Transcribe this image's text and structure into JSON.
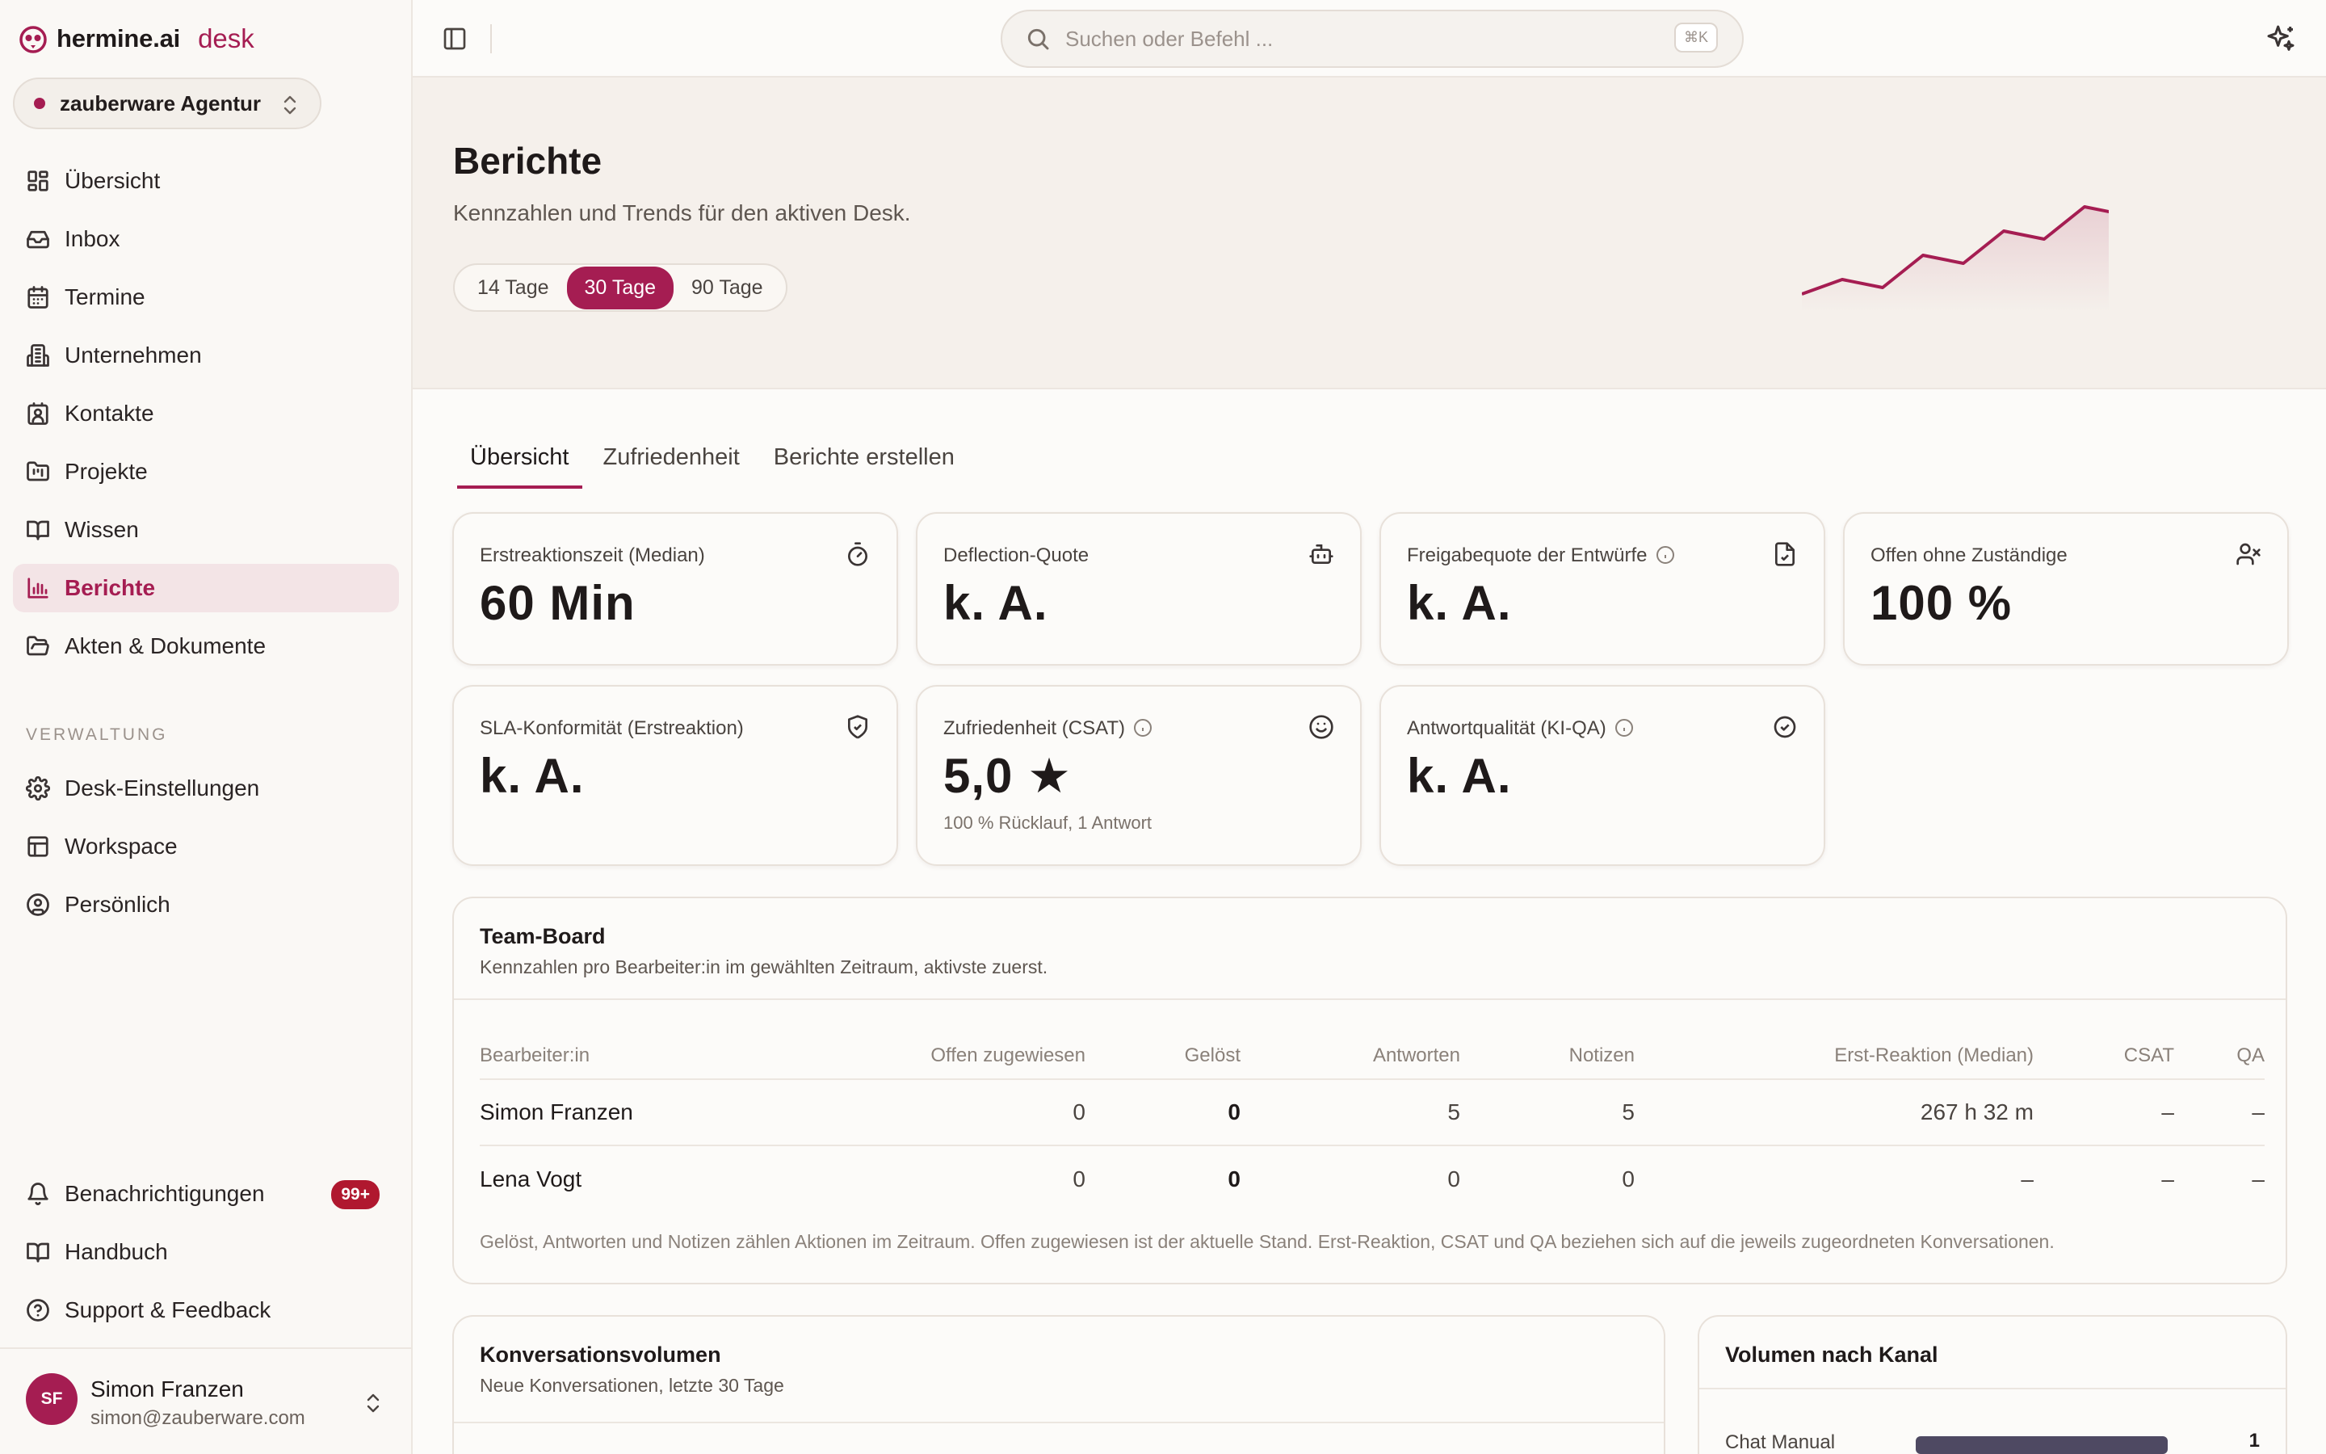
{
  "brand": {
    "name": "hermine.ai",
    "product": "desk"
  },
  "workspace": {
    "name": "zauberware Agentur"
  },
  "nav": {
    "items": [
      {
        "label": "Übersicht",
        "icon": "dashboard-icon"
      },
      {
        "label": "Inbox",
        "icon": "inbox-icon"
      },
      {
        "label": "Termine",
        "icon": "calendar-icon"
      },
      {
        "label": "Unternehmen",
        "icon": "building-icon"
      },
      {
        "label": "Kontakte",
        "icon": "contact-icon"
      },
      {
        "label": "Projekte",
        "icon": "folder-kanban-icon"
      },
      {
        "label": "Wissen",
        "icon": "book-icon"
      },
      {
        "label": "Berichte",
        "icon": "bar-chart-icon",
        "active": true
      },
      {
        "label": "Akten & Dokumente",
        "icon": "folder-open-icon"
      }
    ],
    "section_admin": "VERWALTUNG",
    "admin_items": [
      {
        "label": "Desk-Einstellungen",
        "icon": "gear-icon"
      },
      {
        "label": "Workspace",
        "icon": "layout-icon"
      },
      {
        "label": "Persönlich",
        "icon": "user-circle-icon"
      }
    ],
    "bottom_items": [
      {
        "label": "Benachrichtigungen",
        "icon": "bell-icon",
        "badge": "99+"
      },
      {
        "label": "Handbuch",
        "icon": "book-icon"
      },
      {
        "label": "Support & Feedback",
        "icon": "help-circle-icon"
      }
    ]
  },
  "user": {
    "initials": "SF",
    "name": "Simon Franzen",
    "email": "simon@zauberware.com"
  },
  "topbar": {
    "search_placeholder": "Suchen oder Befehl ...",
    "shortcut": "⌘K"
  },
  "hero": {
    "title": "Berichte",
    "subtitle": "Kennzahlen und Trends für den aktiven Desk.",
    "ranges": [
      "14 Tage",
      "30 Tage",
      "90 Tage"
    ],
    "selected_range": "30 Tage"
  },
  "tabs": [
    "Übersicht",
    "Zufriedenheit",
    "Berichte erstellen"
  ],
  "active_tab": "Übersicht",
  "kpis": [
    {
      "label": "Erstreaktionszeit (Median)",
      "value": "60 Min",
      "icon": "stopwatch-icon"
    },
    {
      "label": "Deflection-Quote",
      "value": "k. A.",
      "icon": "bot-icon"
    },
    {
      "label": "Freigabequote der Entwürfe",
      "value": "k. A.",
      "icon": "file-check-icon",
      "info": true
    },
    {
      "label": "Offen ohne Zuständige",
      "value": "100 %",
      "icon": "user-x-icon"
    },
    {
      "label": "SLA-Konformität (Erstreaktion)",
      "value": "k. A.",
      "icon": "shield-check-icon"
    },
    {
      "label": "Zufriedenheit (CSAT)",
      "value": "5,0 ★",
      "icon": "smile-icon",
      "info": true,
      "note": "100 % Rücklauf, 1 Antwort"
    },
    {
      "label": "Antwortqualität (KI-QA)",
      "value": "k. A.",
      "icon": "badge-check-icon",
      "info": true
    }
  ],
  "team_board": {
    "title": "Team-Board",
    "subtitle": "Kennzahlen pro Bearbeiter:in im gewählten Zeitraum, aktivste zuerst.",
    "columns": [
      "Bearbeiter:in",
      "Offen zugewiesen",
      "Gelöst",
      "Antworten",
      "Notizen",
      "Erst-Reaktion (Median)",
      "CSAT",
      "QA"
    ],
    "rows": [
      [
        "Simon Franzen",
        "0",
        "0",
        "5",
        "5",
        "267 h 32 m",
        "–",
        "–"
      ],
      [
        "Lena Vogt",
        "0",
        "0",
        "0",
        "0",
        "–",
        "–",
        "–"
      ]
    ],
    "footnote": "Gelöst, Antworten und Notizen zählen Aktionen im Zeitraum. Offen zugewiesen ist der aktuelle Stand. Erst-Reaktion, CSAT und QA beziehen sich auf die jeweils zugeordneten Konversationen."
  },
  "volume": {
    "title": "Konversationsvolumen",
    "subtitle": "Neue Konversationen, letzte 30 Tage"
  },
  "channel": {
    "title": "Volumen nach Kanal",
    "rows": [
      {
        "label": "Chat Manual",
        "value": "1"
      }
    ]
  },
  "colors": {
    "accent": "#a51d52",
    "bar": "#4e4962",
    "badge": "#b0182f"
  }
}
